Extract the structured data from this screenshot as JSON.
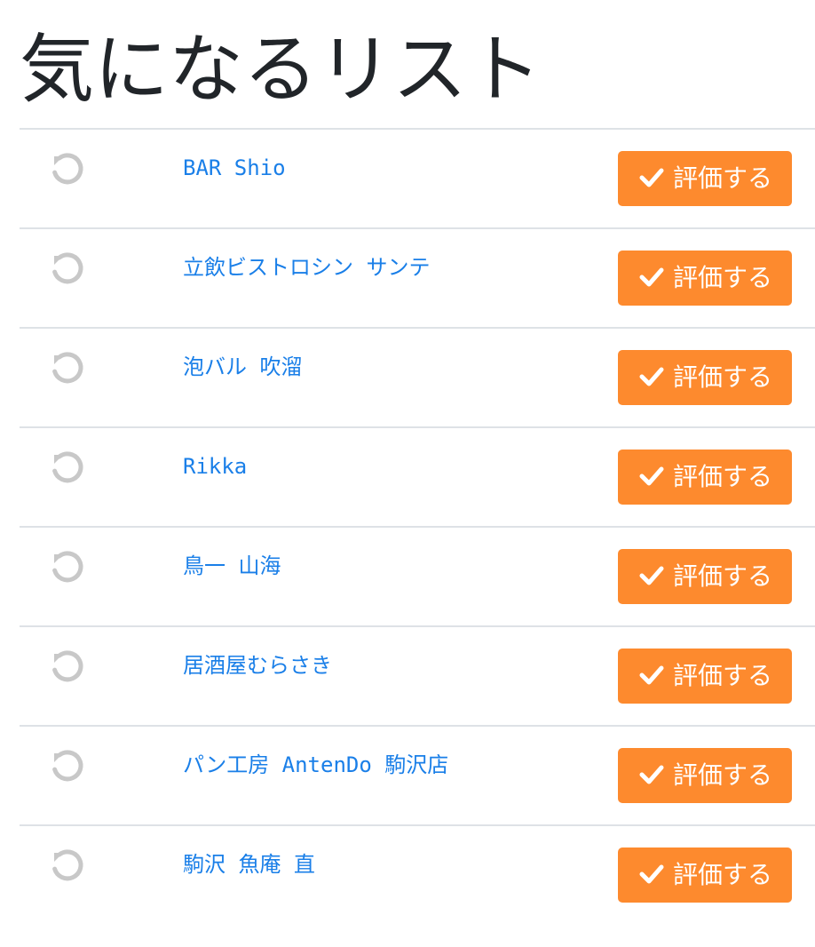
{
  "page": {
    "title": "気になるリスト"
  },
  "colors": {
    "link": "#1a7fe8",
    "button": "#fd8a2e",
    "restore_icon": "#c8c8c8",
    "divider": "#dee2e6"
  },
  "icons": {
    "restore": "undo-icon",
    "check": "check-icon"
  },
  "items": [
    {
      "name": "BAR Shio",
      "button_label": "評価する"
    },
    {
      "name": "立飲ビストロシン サンテ",
      "button_label": "評価する"
    },
    {
      "name": "泡バル 吹溜",
      "button_label": "評価する"
    },
    {
      "name": "Rikka",
      "button_label": "評価する"
    },
    {
      "name": "鳥一 山海",
      "button_label": "評価する"
    },
    {
      "name": "居酒屋むらさき",
      "button_label": "評価する"
    },
    {
      "name": "パン工房 AntenDo 駒沢店",
      "button_label": "評価する"
    },
    {
      "name": "駒沢 魚庵 直",
      "button_label": "評価する"
    }
  ]
}
